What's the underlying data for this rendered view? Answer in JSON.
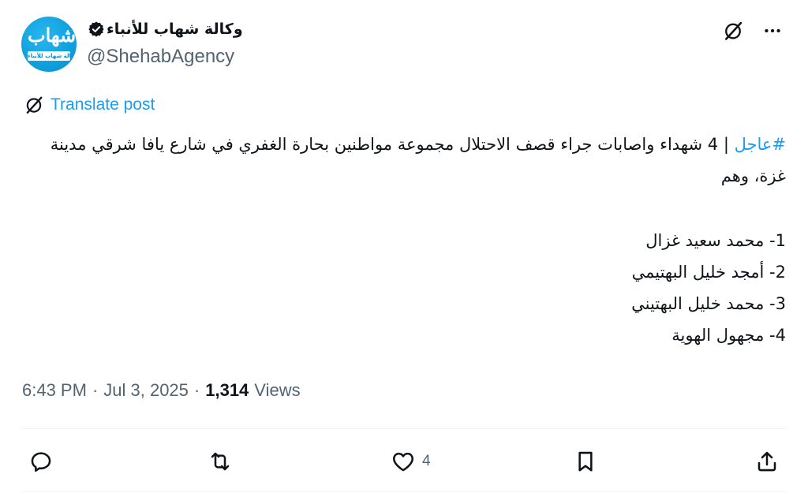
{
  "author": {
    "avatar_script_text": "شهاب",
    "avatar_band_text": "وكالة شهاب للأنباء",
    "display_name": "وكالة شهاب للأنباء",
    "handle": "@ShehabAgency",
    "verified": true
  },
  "header_actions": {
    "grok_icon": "slashed-circle-icon",
    "more_icon": "more-dots-icon"
  },
  "translate": {
    "label": "Translate post",
    "icon": "slashed-circle-icon"
  },
  "post": {
    "hashtag": "#عاجل",
    "headline": " | 4 شهداء واصابات جراء قصف الاحتلال مجموعة مواطنين بحارة الغفري في شارع يافا شرقي مدينة غزة، وهم",
    "list": [
      "1- محمد سعيد غزال",
      "2- أمجد خليل البهتيمي",
      "3- محمد خليل البهتيني",
      "4- مجهول الهوية"
    ]
  },
  "meta": {
    "time": "6:43 PM",
    "separator1": "·",
    "date": "Jul 3, 2025",
    "separator2": "·",
    "views_count": "1,314",
    "views_label": "Views"
  },
  "actions": {
    "reply_icon": "reply-icon",
    "repost_icon": "repost-icon",
    "like_icon": "heart-icon",
    "like_count": "4",
    "bookmark_icon": "bookmark-icon",
    "share_icon": "share-icon"
  },
  "colors": {
    "accent": "#1d9bf0",
    "text_primary": "#0f1419",
    "text_secondary": "#536471",
    "divider": "#eff3f4",
    "avatar_blue": "#0ea0dd"
  }
}
